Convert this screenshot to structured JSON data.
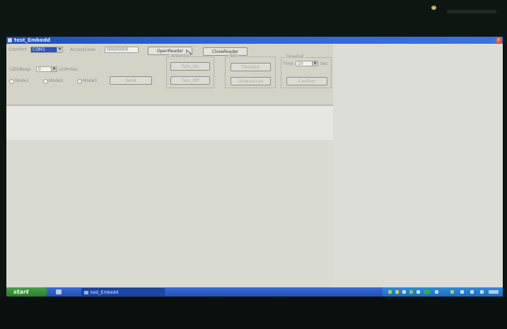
{
  "window": {
    "title": "test_Embedd",
    "close_glyph": "x"
  },
  "toolbar": {
    "comport_label": "ComPort",
    "comport_value": "COM1",
    "access_code_label": "AccessCode",
    "access_code_value": "00000000",
    "open_reader_label": "OpenReader",
    "close_reader_label": "CloseReader"
  },
  "ledbeep": {
    "label": "LED/Beep",
    "value": "0",
    "unit_label": "x10mSec",
    "radio_options": [
      "Mode1",
      "Mode2",
      "Mode3"
    ],
    "send_label": "Send"
  },
  "antenna": {
    "group_title": "Antenna",
    "turn_on_label": "Turn_On",
    "turn_off_label": "Turn_Off"
  },
  "set": {
    "group_title": "Set",
    "timeout_label": "TimeOut",
    "unique_scan_label": "UniqueScan"
  },
  "timeout": {
    "group_title": "TimeOut",
    "time_label": "Time",
    "time_value": "10",
    "sec_label": "Sec",
    "confirm_label": "Confirm"
  },
  "taskbar": {
    "start_label": "start",
    "task_item_label": "test_Embedd"
  },
  "colors": {
    "titlebar": "#2b64d6",
    "taskbar": "#2250b7",
    "start_button": "#2e7d2e",
    "window_bg": "#d4d3c8"
  },
  "icons": {
    "window_icon": "app-icon",
    "pointer": "mouse-cursor-icon"
  }
}
